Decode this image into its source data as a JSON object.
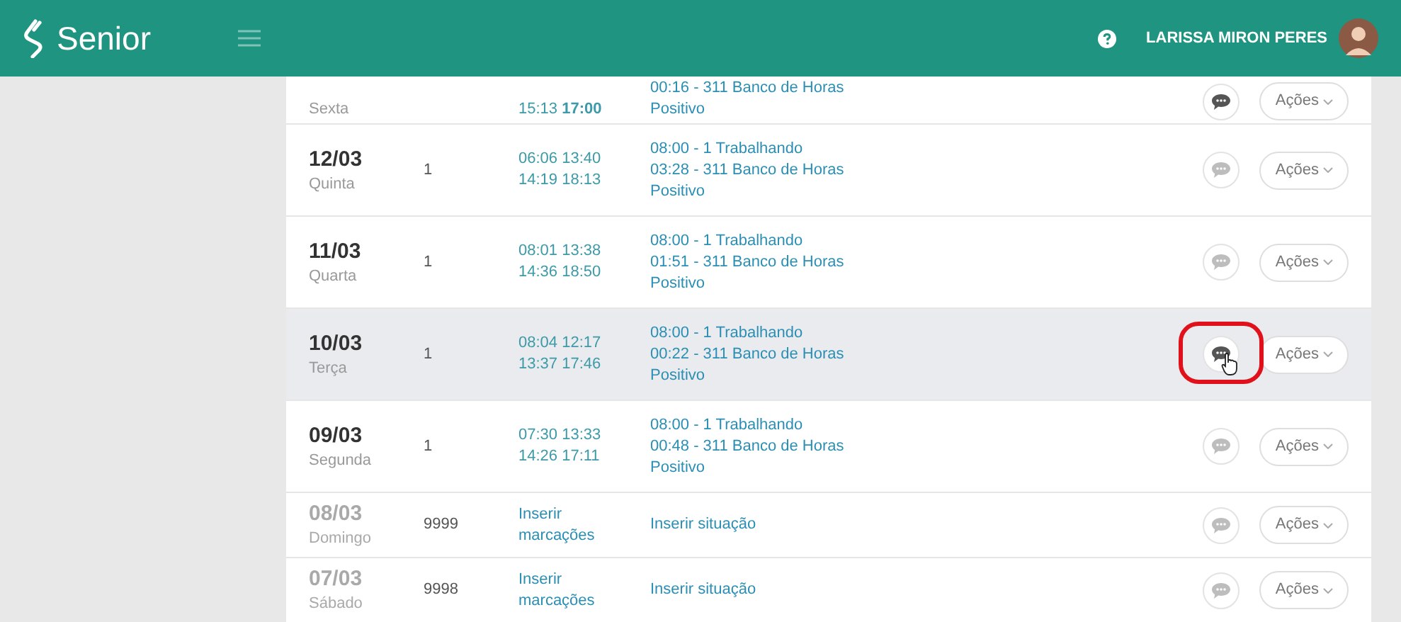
{
  "header": {
    "brand": "Senior",
    "user_name": "LARISSA MIRON PERES"
  },
  "rows": [
    {
      "kind": "partial",
      "date": "",
      "weekday": "Sexta",
      "count": "",
      "times": [
        "15:13 **17:00**"
      ],
      "status": [
        "00:16 - 311 Banco de Horas",
        "Positivo"
      ],
      "selected": false,
      "comment_active": true,
      "circled": false,
      "actions": "Ações"
    },
    {
      "kind": "day",
      "date": "12/03",
      "weekday": "Quinta",
      "count": "1",
      "times": [
        "06:06 13:40",
        "14:19 18:13"
      ],
      "status": [
        "08:00 - 1 Trabalhando",
        "03:28 - 311 Banco de Horas",
        "Positivo"
      ],
      "selected": false,
      "comment_active": false,
      "circled": false,
      "actions": "Ações"
    },
    {
      "kind": "day",
      "date": "11/03",
      "weekday": "Quarta",
      "count": "1",
      "times": [
        "08:01 13:38",
        "14:36 18:50"
      ],
      "status": [
        "08:00 - 1 Trabalhando",
        "01:51 - 311 Banco de Horas",
        "Positivo"
      ],
      "selected": false,
      "comment_active": false,
      "circled": false,
      "actions": "Ações"
    },
    {
      "kind": "day",
      "date": "10/03",
      "weekday": "Terça",
      "count": "1",
      "times": [
        "08:04 12:17",
        "13:37 17:46"
      ],
      "status": [
        "08:00 - 1 Trabalhando",
        "00:22 - 311 Banco de Horas",
        "Positivo"
      ],
      "selected": true,
      "comment_active": true,
      "circled": true,
      "actions": "Ações"
    },
    {
      "kind": "day",
      "date": "09/03",
      "weekday": "Segunda",
      "count": "1",
      "times": [
        "07:30 13:33",
        "14:26 17:11"
      ],
      "status": [
        "08:00 - 1 Trabalhando",
        "00:48 - 311 Banco de Horas",
        "Positivo"
      ],
      "selected": false,
      "comment_active": false,
      "circled": false,
      "actions": "Ações"
    },
    {
      "kind": "off",
      "date": "08/03",
      "weekday": "Domingo",
      "count": "9999",
      "times": [
        "Inserir",
        "marcações"
      ],
      "status": [
        "Inserir situação"
      ],
      "selected": false,
      "comment_active": false,
      "circled": false,
      "actions": "Ações"
    },
    {
      "kind": "off",
      "date": "07/03",
      "weekday": "Sábado",
      "count": "9998",
      "times": [
        "Inserir",
        "marcações"
      ],
      "status": [
        "Inserir situação"
      ],
      "selected": false,
      "comment_active": false,
      "circled": false,
      "actions": "Ações"
    }
  ]
}
